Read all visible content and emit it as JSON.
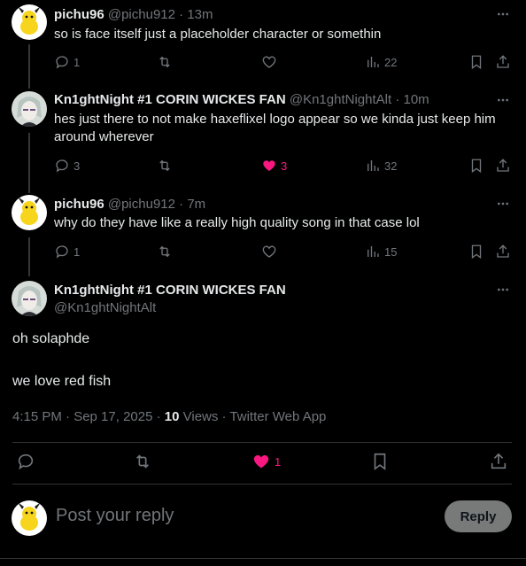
{
  "posts": [
    {
      "name": "pichu96",
      "handle": "@pichu912",
      "time": "· 13m",
      "text": "so is face itself just a placeholder character or somethin",
      "replies": "1",
      "likes": "",
      "views": "22"
    },
    {
      "name": "Kn1ghtNight #1 CORIN WICKES FAN",
      "handle": "@Kn1ghtNightAlt",
      "time": "· 10m",
      "text": "hes just there to not make haxeflixel logo appear so we kinda just keep him around wherever",
      "replies": "3",
      "likes": "3",
      "views": "32"
    },
    {
      "name": "pichu96",
      "handle": "@pichu912",
      "time": "· 7m",
      "text": "why do they have like a really high quality song in that case lol",
      "replies": "1",
      "likes": "",
      "views": "15"
    }
  ],
  "main": {
    "name": "Kn1ghtNight #1 CORIN WICKES FAN",
    "handle": "@Kn1ghtNightAlt",
    "line1": "oh solaphde",
    "line2": "we love red fish",
    "time": "4:15 PM · Sep 17, 2025 · ",
    "views_count": "10",
    "views_label": " Views · Twitter Web App",
    "likes": "1"
  },
  "reply": {
    "placeholder": "Post your reply",
    "button": "Reply"
  },
  "colors": {
    "like": "#f91880",
    "muted": "#71767b",
    "text": "#e7e9ea"
  }
}
